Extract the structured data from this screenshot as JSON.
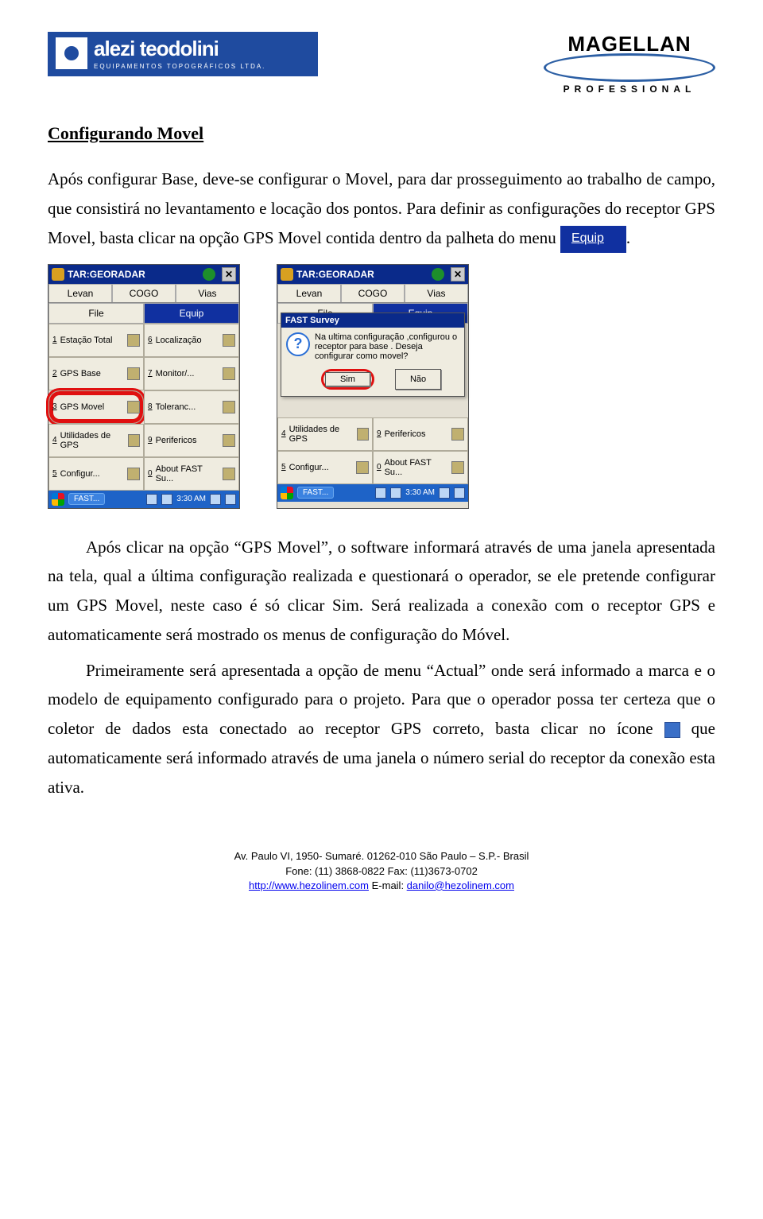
{
  "header": {
    "left_logo": {
      "line1": "alezi teodolini",
      "line2": "EQUIPAMENTOS TOPOGRÁFICOS LTDA."
    },
    "right_logo": {
      "brand": "MAGELLAN",
      "sub": "PROFESSIONAL"
    }
  },
  "section_title": "Configurando Movel",
  "para1_a": "Após configurar Base, deve-se configurar o Movel, para dar prosseguimento ao trabalho de campo, que consistirá no levantamento e locação dos pontos. Para definir as configurações do receptor GPS Movel, basta clicar na opção GPS Movel contida dentro da palheta do menu ",
  "equip_btn_label": "Equip",
  "para1_b": ".",
  "screen_left": {
    "title": "TAR:GEORADAR",
    "tabs_top": [
      "Levan",
      "COGO",
      "Vias"
    ],
    "tabs_sub": [
      "File",
      "Equip"
    ],
    "active_sub_tab": "Equip",
    "menu": [
      {
        "n": "1",
        "label": "Estação Total"
      },
      {
        "n": "6",
        "label": "Localização"
      },
      {
        "n": "2",
        "label": "GPS Base"
      },
      {
        "n": "7",
        "label": "Monitor/..."
      },
      {
        "n": "3",
        "label": "GPS Movel",
        "circled": true
      },
      {
        "n": "8",
        "label": "Toleranc..."
      },
      {
        "n": "4",
        "label": "Utilidades de GPS"
      },
      {
        "n": "9",
        "label": "Perifericos"
      },
      {
        "n": "5",
        "label": "Configur..."
      },
      {
        "n": "0",
        "label": "About FAST Su..."
      }
    ],
    "taskbar": {
      "task": "FAST...",
      "time": "3:30 AM"
    }
  },
  "screen_right": {
    "title": "TAR:GEORADAR",
    "tabs_top": [
      "Levan",
      "COGO",
      "Vias"
    ],
    "tabs_sub": [
      "File",
      "Equip"
    ],
    "active_sub_tab": "Equip",
    "dialog": {
      "title": "FAST Survey",
      "message": "Na ultima configuração ,configurou o receptor para base . Deseja configurar como movel?",
      "yes": "Sim",
      "no": "Não"
    },
    "menu_visible_bottom": [
      {
        "n": "4",
        "label": "Utilidades de GPS"
      },
      {
        "n": "9",
        "label": "Perifericos"
      },
      {
        "n": "5",
        "label": "Configur..."
      },
      {
        "n": "0",
        "label": "About FAST Su..."
      }
    ],
    "taskbar": {
      "task": "FAST...",
      "time": "3:30 AM"
    }
  },
  "para2": "Após clicar na opção “GPS Movel”, o software informará através de uma janela apresentada na tela, qual a última configuração realizada e questionará o operador, se ele pretende configurar um GPS Movel, neste caso é só clicar Sim. Será realizada a conexão com o receptor GPS e automaticamente será mostrado os menus de configuração do Móvel.",
  "para3_a": "Primeiramente será apresentada a opção de menu “Actual” onde será informado a marca e o modelo de equipamento configurado para o projeto. Para que o operador possa ter certeza que o coletor de dados esta conectado ao receptor GPS correto, basta clicar no ícone ",
  "inline_icon_text": "i",
  "para3_b": " que automaticamente será informado através de uma janela o número serial do receptor da conexão esta ativa.",
  "footer": {
    "line1": "Av. Paulo VI, 1950- Sumaré.  01262-010   São Paulo – S.P.- Brasil",
    "line2": "Fone: (11) 3868-0822   Fax: (11)3673-0702",
    "link": "http://www.hezolinem.com",
    "email_label": " E-mail: ",
    "email": "danilo@hezolinem.com"
  }
}
